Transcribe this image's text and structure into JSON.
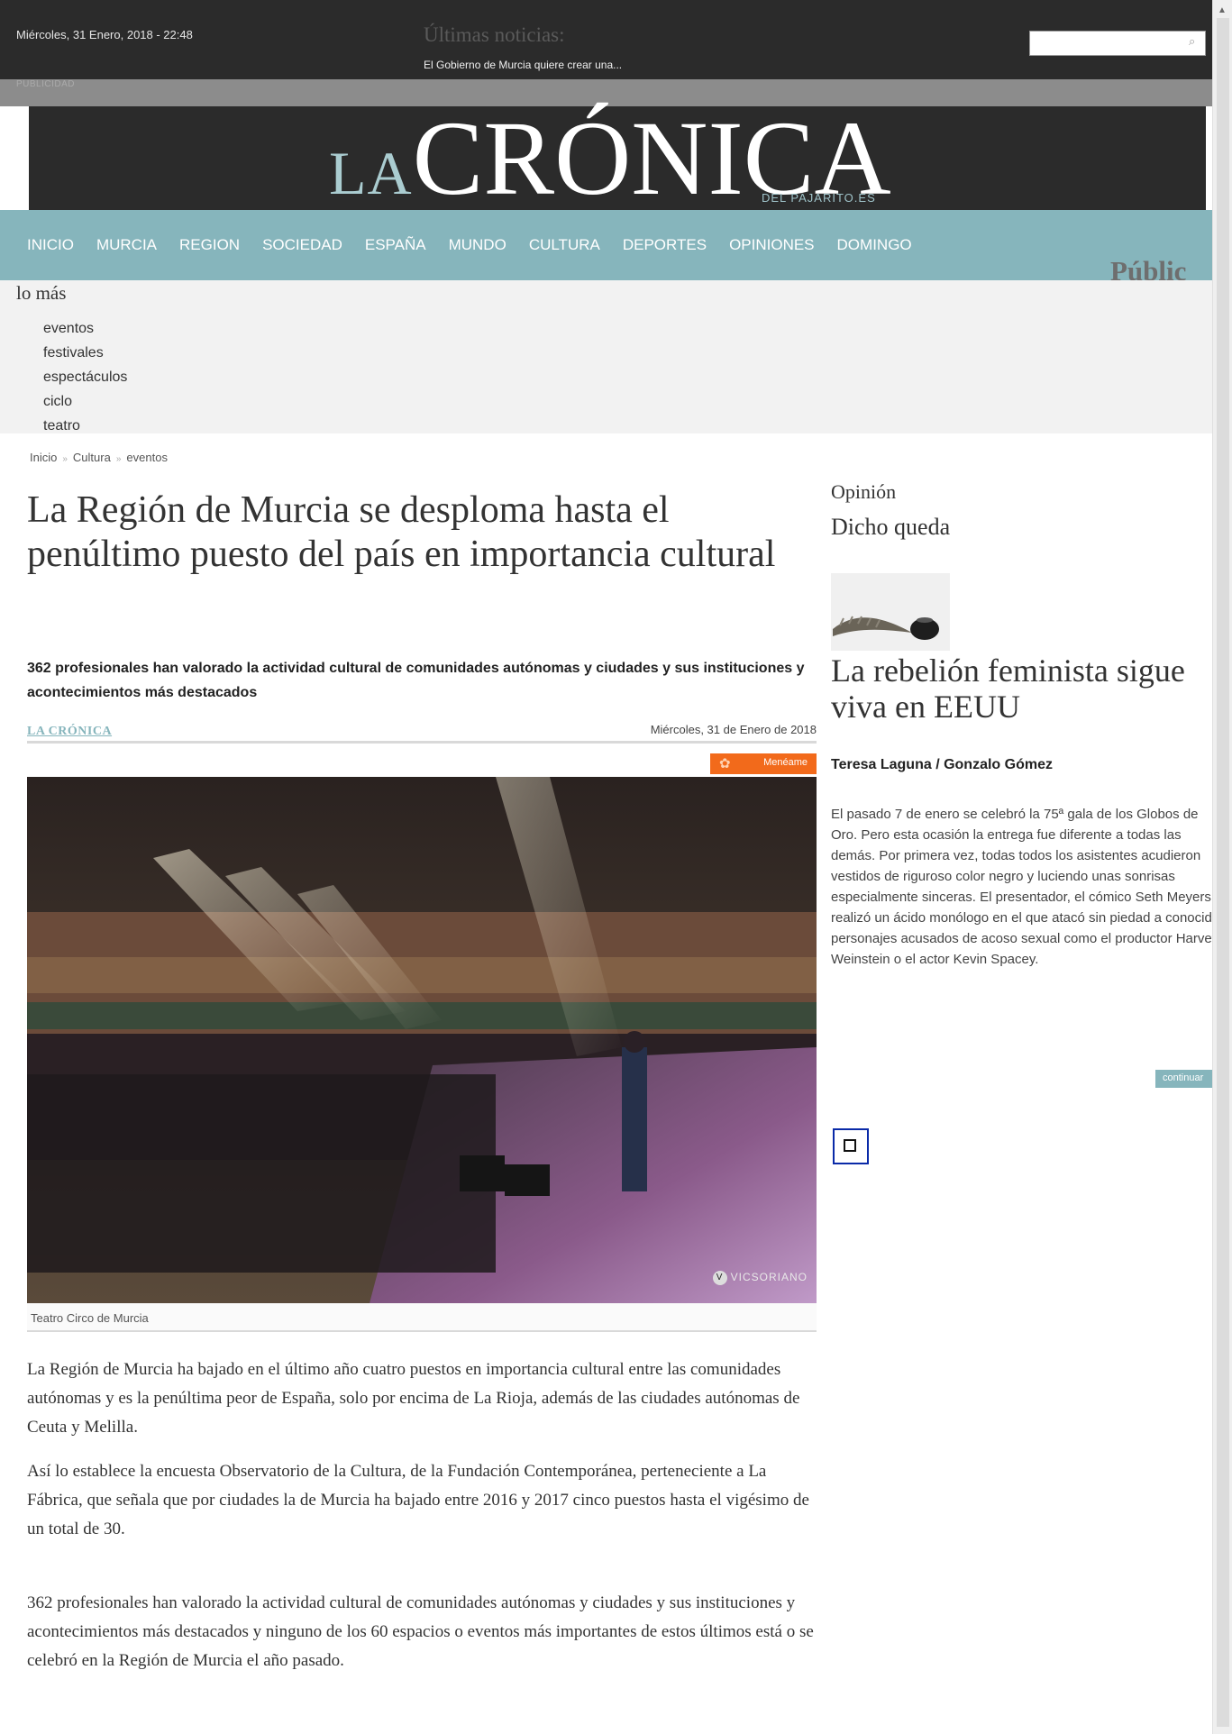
{
  "topbar": {
    "date": "Miércoles, 31 Enero, 2018 - 22:48",
    "ultimas_label": "Últimas noticias:",
    "ticker": "El Gobierno de Murcia quiere crear una...",
    "search_placeholder": ""
  },
  "publicidad_label": "PUBLICIDAD",
  "logo": {
    "la": "LA",
    "cronica": "CRÓNICA",
    "sub": "DEL PAJARITO.ES"
  },
  "nav": [
    "INICIO",
    "MURCIA",
    "REGION",
    "SOCIEDAD",
    "ESPAÑA",
    "MUNDO",
    "CULTURA",
    "DEPORTES",
    "OPINIONES",
    "DOMINGO"
  ],
  "publico": "Públic",
  "lomas": {
    "title": "lo más",
    "tags": [
      "eventos",
      "festivales",
      "espectáculos",
      "ciclo",
      "teatro"
    ]
  },
  "breadcrumb": [
    "Inicio",
    "Cultura",
    "eventos"
  ],
  "breadcrumb_sep": "»",
  "article": {
    "headline": "La Región de Murcia se desploma hasta el penúltimo puesto del país en importancia cultural",
    "subtitle": "362 profesionales han valorado la actividad cultural de comunidades autónomas y ciudades y sus instituciones y acontecimientos más destacados",
    "source": "LA CRÓNICA",
    "date": "Miércoles, 31 de Enero de 2018",
    "meneame": "Menéame",
    "photo_watermark": "VICSORIANO",
    "caption": "Teatro Circo de Murcia",
    "paragraphs": [
      "La Región de Murcia ha bajado en el último año cuatro puestos en importancia cultural entre las comunidades autónomas y es la penúltima peor de España, solo por encima de La Rioja, además de las ciudades autónomas de Ceuta y Melilla.",
      "Así lo establece la encuesta Observatorio de la Cultura, de la Fundación Contemporánea, perteneciente a La Fábrica, que señala que por ciudades la de Murcia ha bajado entre 2016 y 2017 cinco puestos hasta el vigésimo de un total de 30.",
      "362 profesionales han valorado la actividad cultural de comunidades autónomas y ciudades y sus instituciones y acontecimientos más destacados y ninguno de los 60 espacios o eventos más importantes de estos últimos está o se celebró en la Región de Murcia el año pasado."
    ]
  },
  "sidebar": {
    "section": "Opinión",
    "column": "Dicho queda",
    "title": "La rebelión feminista sigue viva en EEUU",
    "author": "Teresa Laguna / Gonzalo Gómez",
    "text": "El pasado 7 de enero se celebró la 75ª gala de los Globos de Oro. Pero esta ocasión la entrega fue diferente a todas las demás. Por primera vez, todas todos los asistentes acudieron vestidos de riguroso color negro y luciendo unas sonrisas especialmente sinceras. El presentador, el cómico Seth Meyers, realizó un ácido monólogo en el que atacó sin piedad a conocidos personajes acusados de acoso sexual como el productor Harvey Weinstein o el actor Kevin Spacey.",
    "continue_label": "continuar"
  },
  "colors": {
    "dark": "#2b2b2b",
    "teal": "#86b5bc",
    "orange": "#f26a1b",
    "adbox_border": "#0a2aa8"
  }
}
